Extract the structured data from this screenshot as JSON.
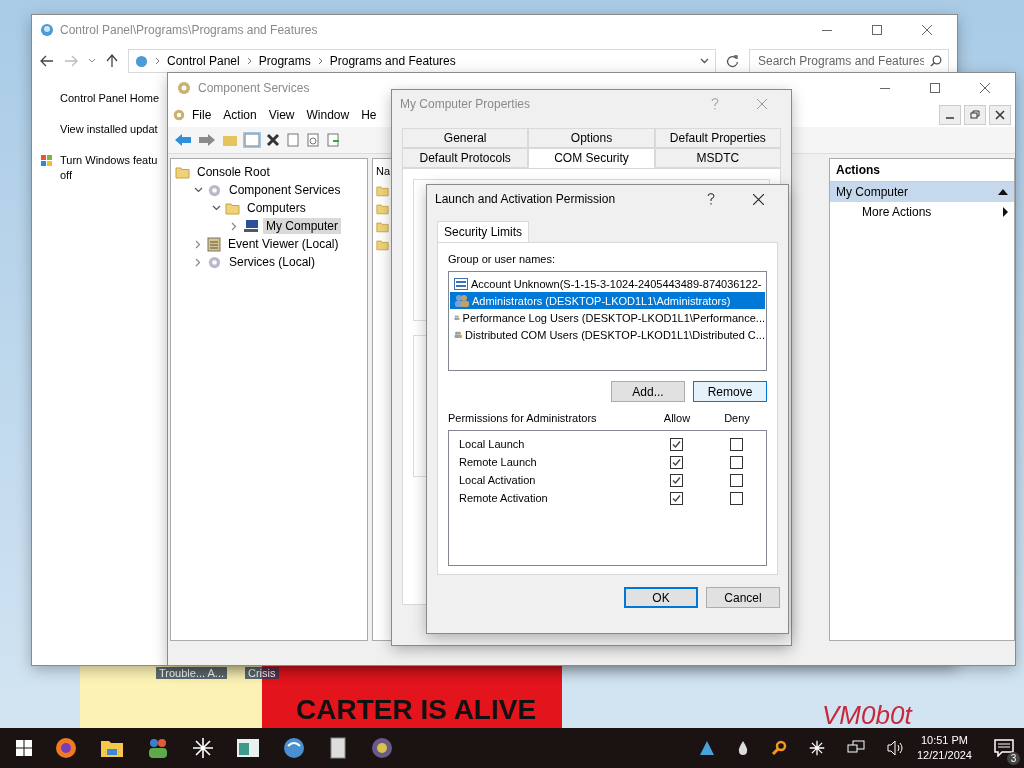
{
  "desktop": {
    "wallpaper_texts": [
      "CARTER IS ALIVE",
      "VM0b0t"
    ],
    "icons": [
      {
        "label": "Trouble... A..."
      },
      {
        "label": "Crisis"
      }
    ]
  },
  "programs_window": {
    "title": "Control Panel\\Programs\\Programs and Features",
    "breadcrumb": [
      "Control Panel",
      "Programs",
      "Programs and Features"
    ],
    "search": {
      "placeholder": "Search Programs and Features"
    },
    "sidebar": [
      {
        "lines": [
          "Control Panel Home"
        ],
        "kind": "link"
      },
      {
        "lines": [
          "View installed updat"
        ],
        "kind": "link"
      },
      {
        "lines": [
          "Turn Windows featu",
          "off"
        ],
        "kind": "shield"
      }
    ]
  },
  "component_services": {
    "title": "Component Services",
    "menu": [
      "File",
      "Action",
      "View",
      "Window",
      "He"
    ],
    "tree": [
      {
        "label": "Console Root",
        "kind": "folder",
        "selected": false,
        "children": [
          {
            "label": "Component Services",
            "kind": "gear",
            "selected": false,
            "expanded": true,
            "children": [
              {
                "label": "Computers",
                "kind": "folder",
                "selected": false,
                "expanded": true,
                "children": [
                  {
                    "label": "My Computer",
                    "kind": "computer",
                    "selected": true,
                    "expanded": false
                  }
                ]
              }
            ]
          },
          {
            "label": "Event Viewer (Local)",
            "kind": "log",
            "selected": false,
            "expanded": false
          },
          {
            "label": "Services (Local)",
            "kind": "gear",
            "selected": false,
            "expanded": false
          }
        ]
      }
    ],
    "list_header": "Na",
    "actions": {
      "title": "Actions",
      "section": "My Computer",
      "items": [
        "More Actions"
      ]
    }
  },
  "properties_dialog": {
    "title": "My Computer Properties",
    "tab_rows": [
      [
        {
          "label": "General",
          "selected": false
        },
        {
          "label": "Options",
          "selected": false
        },
        {
          "label": "Default Properties",
          "selected": false
        }
      ],
      [
        {
          "label": "Default Protocols",
          "selected": false
        },
        {
          "label": "COM Security",
          "selected": true
        },
        {
          "label": "MSDTC",
          "selected": false
        }
      ]
    ]
  },
  "permission_dialog": {
    "title": "Launch and Activation Permission",
    "tab": "Security Limits",
    "users_label": "Group or user names:",
    "users": [
      {
        "name": "Account Unknown(S-1-15-3-1024-2405443489-874036122-",
        "kind": "unknown",
        "selected": false
      },
      {
        "name": "Administrators (DESKTOP-LKOD1L1\\Administrators)",
        "kind": "group",
        "selected": true
      },
      {
        "name": "Performance Log Users (DESKTOP-LKOD1L1\\Performance...",
        "kind": "group",
        "selected": false
      },
      {
        "name": "Distributed COM Users (DESKTOP-LKOD1L1\\Distributed C...",
        "kind": "group",
        "selected": false
      }
    ],
    "buttons": [
      "Add...",
      "Remove"
    ],
    "permissions_label": "Permissions for Administrators",
    "allow_label": "Allow",
    "deny_label": "Deny",
    "permissions": [
      {
        "name": "Local Launch",
        "allow": true,
        "deny": false
      },
      {
        "name": "Remote Launch",
        "allow": true,
        "deny": false
      },
      {
        "name": "Local Activation",
        "allow": true,
        "deny": false
      },
      {
        "name": "Remote Activation",
        "allow": true,
        "deny": false
      }
    ],
    "footer_buttons": [
      "OK",
      "Cancel"
    ]
  },
  "taskbar": {
    "time": "10:51 PM",
    "date": "12/21/2024",
    "notifications": "3"
  }
}
